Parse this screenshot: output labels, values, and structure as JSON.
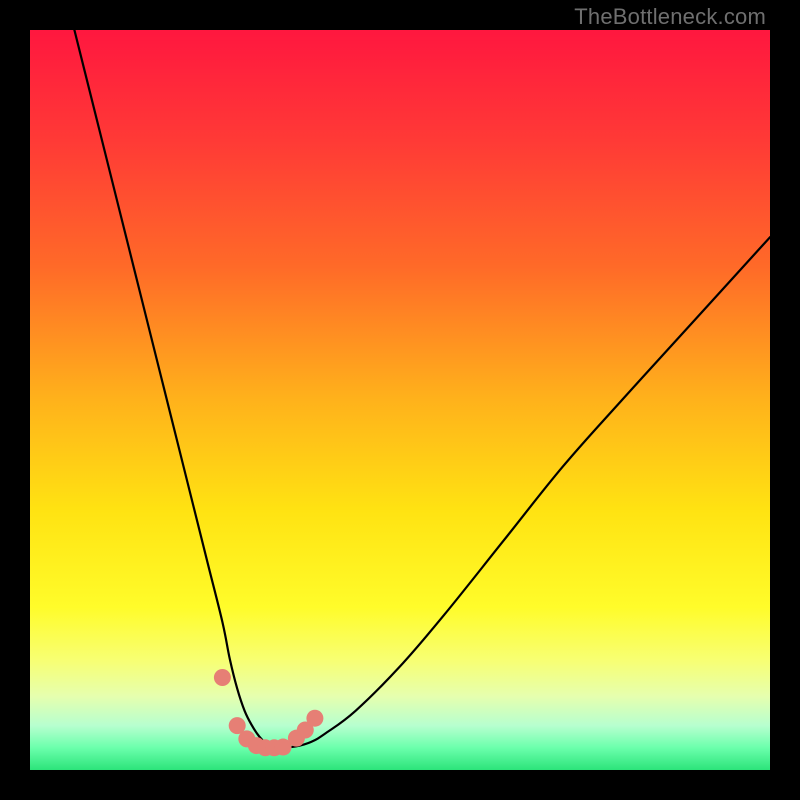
{
  "watermark": "TheBottleneck.com",
  "colors": {
    "frame": "#000000",
    "curve": "#000000",
    "marker": "#e67f75",
    "gradient_stops": [
      {
        "offset": 0.0,
        "color": "#ff173f"
      },
      {
        "offset": 0.15,
        "color": "#ff3a36"
      },
      {
        "offset": 0.32,
        "color": "#ff6a28"
      },
      {
        "offset": 0.5,
        "color": "#ffb21b"
      },
      {
        "offset": 0.65,
        "color": "#ffe312"
      },
      {
        "offset": 0.78,
        "color": "#fffc2a"
      },
      {
        "offset": 0.85,
        "color": "#f8ff71"
      },
      {
        "offset": 0.9,
        "color": "#e6ffae"
      },
      {
        "offset": 0.94,
        "color": "#b7ffcf"
      },
      {
        "offset": 0.97,
        "color": "#6bffac"
      },
      {
        "offset": 1.0,
        "color": "#2ce47a"
      }
    ]
  },
  "chart_data": {
    "type": "line",
    "title": "",
    "xlabel": "",
    "ylabel": "",
    "xlim": [
      0,
      100
    ],
    "ylim": [
      0,
      100
    ],
    "grid": false,
    "legend": false,
    "series": [
      {
        "name": "bottleneck-curve",
        "x": [
          6,
          8,
          10,
          12,
          14,
          16,
          18,
          20,
          22,
          24,
          26,
          27,
          28,
          29,
          30,
          31,
          32,
          33,
          34,
          36,
          38,
          40,
          44,
          50,
          56,
          64,
          72,
          80,
          90,
          100
        ],
        "y": [
          100,
          92,
          84,
          76,
          68,
          60,
          52,
          44,
          36,
          28,
          20,
          15,
          11,
          8,
          6,
          4.5,
          3.5,
          3,
          3,
          3.2,
          3.8,
          5,
          8,
          14,
          21,
          31,
          41,
          50,
          61,
          72
        ],
        "type": "line"
      },
      {
        "name": "markers",
        "x": [
          26.0,
          28.0,
          29.3,
          30.6,
          31.8,
          33.0,
          34.2,
          36.0,
          37.2,
          38.5
        ],
        "y": [
          12.5,
          6.0,
          4.2,
          3.3,
          3.0,
          3.0,
          3.1,
          4.3,
          5.4,
          7.0
        ],
        "type": "scatter"
      }
    ],
    "annotations": []
  }
}
